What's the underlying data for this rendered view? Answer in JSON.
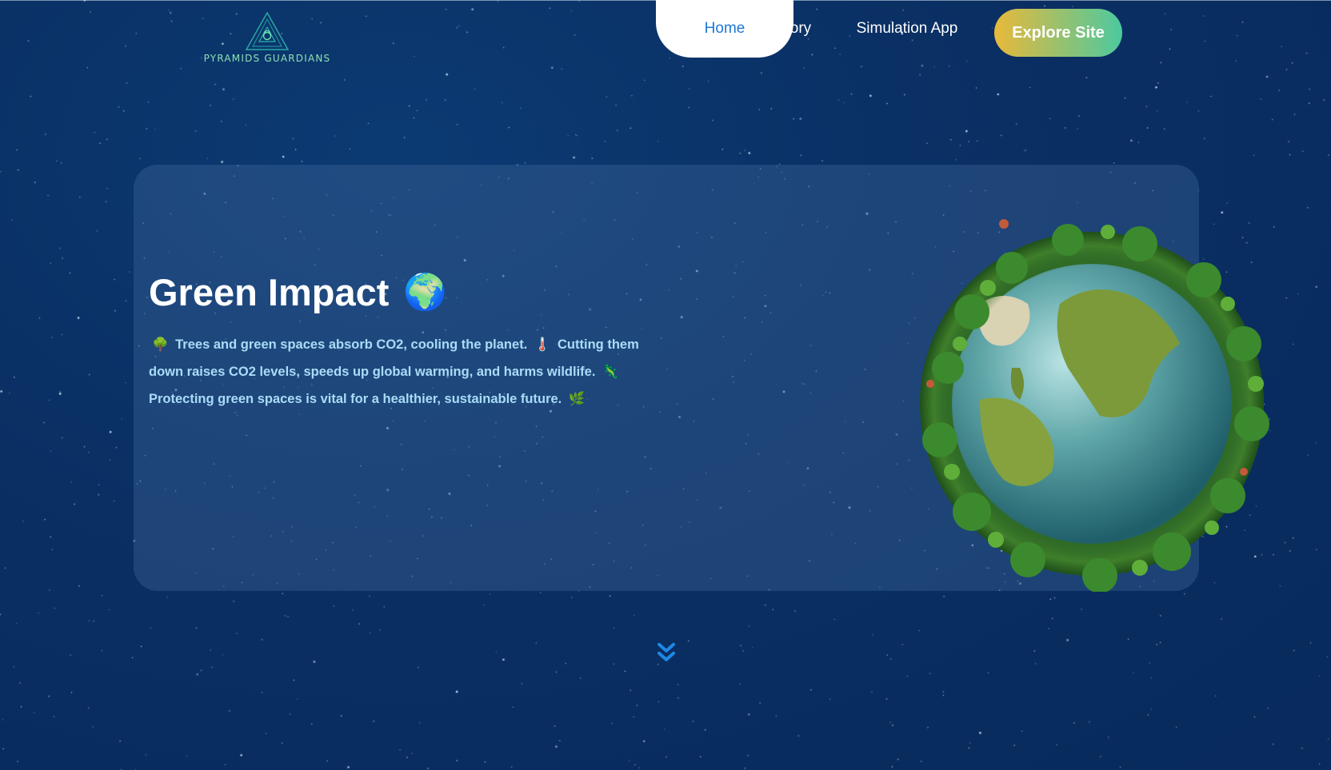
{
  "header": {
    "logo_text": "PYRAMIDS GUARDIANS",
    "nav": [
      {
        "label": "Home",
        "active": true
      },
      {
        "label": "Story",
        "active": false
      },
      {
        "label": "Simulation App",
        "active": false
      }
    ],
    "cta_label": "Explore Site"
  },
  "hero": {
    "title": "Green Impact",
    "title_emoji": "🌍",
    "paragraph": [
      {
        "emoji": "🌳",
        "text": "Trees and green spaces absorb CO2, cooling the planet."
      },
      {
        "emoji": "🌡️",
        "text": "Cutting them down raises CO2 levels, speeds up global warming, and harms wildlife."
      },
      {
        "emoji": "🦎",
        "text": "Protecting green spaces is vital for a healthier, sustainable future."
      },
      {
        "emoji": "🌿",
        "text": ""
      }
    ]
  },
  "colors": {
    "background": "#0a2f63",
    "active_nav_text": "#1e78d8",
    "cta_gradient_start": "#e8b93a",
    "cta_gradient_end": "#4cc9a0",
    "hero_text": "#a9dcf7",
    "scroll_icon": "#1e88e5"
  },
  "icons": {
    "logo": "pyramid-eye-icon",
    "scroll": "double-chevron-down-icon",
    "illustration": "green-earth-globe"
  }
}
